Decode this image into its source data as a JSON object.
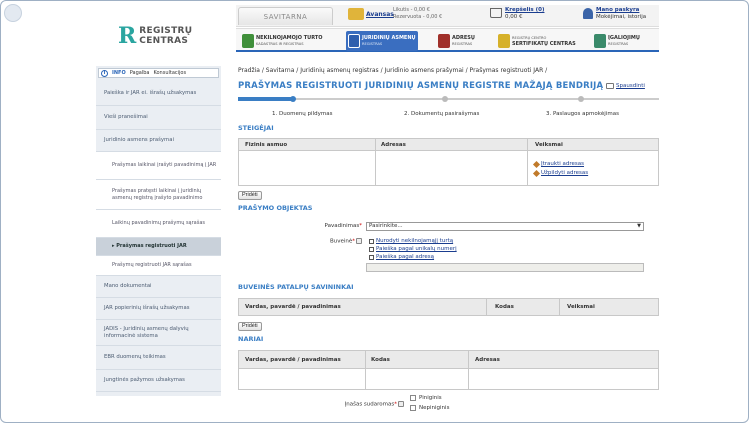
{
  "header": {
    "logo_line1": "REGISTRŲ",
    "logo_line2": "CENTRAS",
    "tab_label": "SAVITARNA",
    "avansas_label": "Avansas",
    "likutis": "Likutis - 0,00 €",
    "rezervuota": "Rezervuota - 0,00 €",
    "cart_label": "Krepšelis (0)",
    "cart_amount": "0,00 €",
    "user_label": "Mano paskyra",
    "user_sub": "Mokėjimai, istorija"
  },
  "modules": [
    {
      "title": "NEKILNOJAMOJO TURTO",
      "sub": "KADASTRAS IR REGISTRAS",
      "color": "#3f8f3a"
    },
    {
      "title": "JURIDINIŲ ASMENŲ",
      "sub": "REGISTRAS",
      "color": "#2f5fae"
    },
    {
      "title": "ADRESŲ",
      "sub": "REGISTRAS",
      "color": "#a0302a"
    },
    {
      "title": "SERTIFIKATŲ CENTRAS",
      "sub": "REGISTRŲ CENTRO",
      "color": "#d6b12a"
    },
    {
      "title": "ĮGALIOJIMŲ",
      "sub": "REGISTRAS",
      "color": "#3a8a6a"
    }
  ],
  "sidebar": {
    "info_tabs": [
      "INFO",
      "Pagalba",
      "Konsultacijos"
    ],
    "items": [
      "Paieška ir JAR ei. išrašų užsakymas",
      "Vieši pranešimai",
      "Juridinio asmens prašymai",
      "Prašymas laikinai įrašyti pavadinimą į JAR",
      "Prašymas pratęsti laikinai į juridinių asmenų registrą įrašyto pavadinimo",
      "Laikinų pavadinimų prašymų sąrašas",
      "Prašymas registruoti JAR",
      "Prašymų registruoti JAR sąrašas",
      "Mano dokumentai",
      "JAR popierinių išrašų užsakymas",
      "JADIS - Juridinių asmenų dalyvių informacinė sistema",
      "EBR duomenų teikimas",
      "Jungtinės pažymos užsakymas"
    ]
  },
  "breadcrumb": "Pradžia / Savitarna / Juridinių asmenų registras / Juridinio asmens prašymai / Prašymas registruoti JAR /",
  "page_title": "PRAŠYMAS REGISTRUOTI JURIDINIŲ ASMENŲ REGISTRE MAŽĄJĄ BENDRIJĄ",
  "print_label": "Spausdinti",
  "steps": [
    "1. Duomenų pildymas",
    "2. Dokumentų pasirašymas",
    "3. Paslaugos apmokėjimas"
  ],
  "steigejai": {
    "title": "STEIGĖJAI",
    "cols": [
      "Fizinis asmuo",
      "Adresas",
      "Veiksmai"
    ],
    "actions": [
      "Įtraukti adresas",
      "Užpildyti adresas"
    ],
    "add_button": "Pridėti"
  },
  "objektas": {
    "title": "PRAŠYMO OBJEKTAS",
    "pavadinimas_label": "Pavadinimas",
    "select_value": "Pasirinkite...",
    "buveine_label": "Buveinė",
    "links": [
      "Nurodyti nekilnojamąjį turtą",
      "Paieška pagal unikalų numerį",
      "Paieška pagal adresą"
    ]
  },
  "savininkai": {
    "title": "BUVEINĖS PATALPŲ SAVININKAI",
    "cols": [
      "Vardas, pavardė / pavadinimas",
      "Kodas",
      "Veiksmai"
    ],
    "add_button": "Pridėti"
  },
  "nariai": {
    "title": "NARIAI",
    "cols": [
      "Vardas, pavardė / pavadinimas",
      "Kodas",
      "Adresas"
    ],
    "inasas_label": "Įnašas sudaromas",
    "options": [
      "Piniginis",
      "Nepiniginis"
    ]
  }
}
